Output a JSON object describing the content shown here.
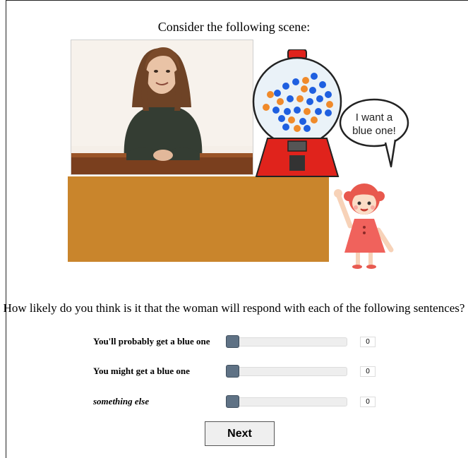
{
  "heading": "Consider the following scene:",
  "speech_bubble": {
    "line1": "I want a",
    "line2": "blue one!"
  },
  "question": "How likely do you think is it that the woman will respond with each of the following sentences?",
  "sliders": [
    {
      "label": "You'll probably get a blue one",
      "value": "0",
      "level": 0
    },
    {
      "label": "You might get a blue one",
      "value": "0",
      "level": 0
    },
    {
      "label": "something else",
      "value": "0",
      "level": 0
    }
  ],
  "next_label": "Next",
  "colors": {
    "counter": "#c9852c",
    "gumball_red": "#e0231c",
    "gumball_blue": "#1f5fe0",
    "gumball_orange": "#f08a2a",
    "slider_thumb": "#5f7285",
    "child_dress": "#f0625c"
  }
}
